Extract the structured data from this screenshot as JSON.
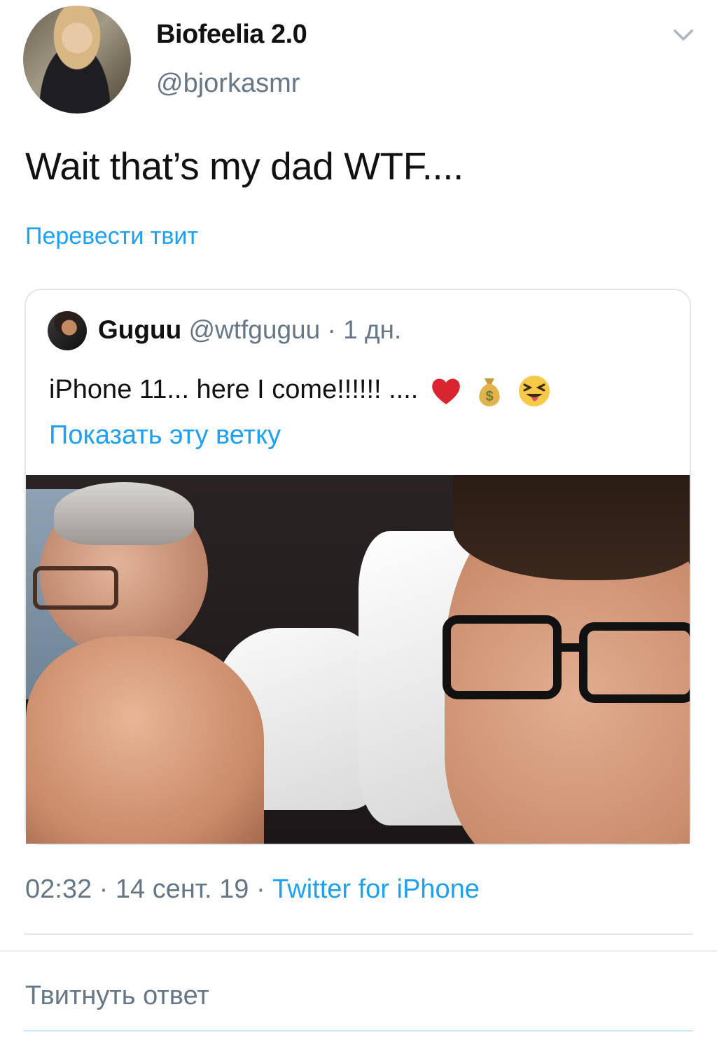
{
  "author": {
    "display_name": "Biofeelia 2.0",
    "handle": "@bjorkasmr"
  },
  "tweet": {
    "text": "Wait that’s my dad WTF....",
    "translate_label": "Перевести твит",
    "timestamp": "02:32 · 14 сент. 19 · ",
    "source": "Twitter for iPhone"
  },
  "quoted": {
    "name": "Guguu",
    "handle": "@wtfguguu",
    "time": " · 1 дн.",
    "text": "iPhone 11... here I come!!!!!!  ....",
    "emojis": [
      "heart-emoji",
      "money-bag-emoji",
      "squinting-tongue-emoji"
    ],
    "show_thread_label": "Показать эту ветку"
  },
  "reply": {
    "placeholder": "Твитнуть ответ"
  },
  "colors": {
    "link": "#1da1f2",
    "secondary": "#657786",
    "border": "#e1e8ed"
  }
}
